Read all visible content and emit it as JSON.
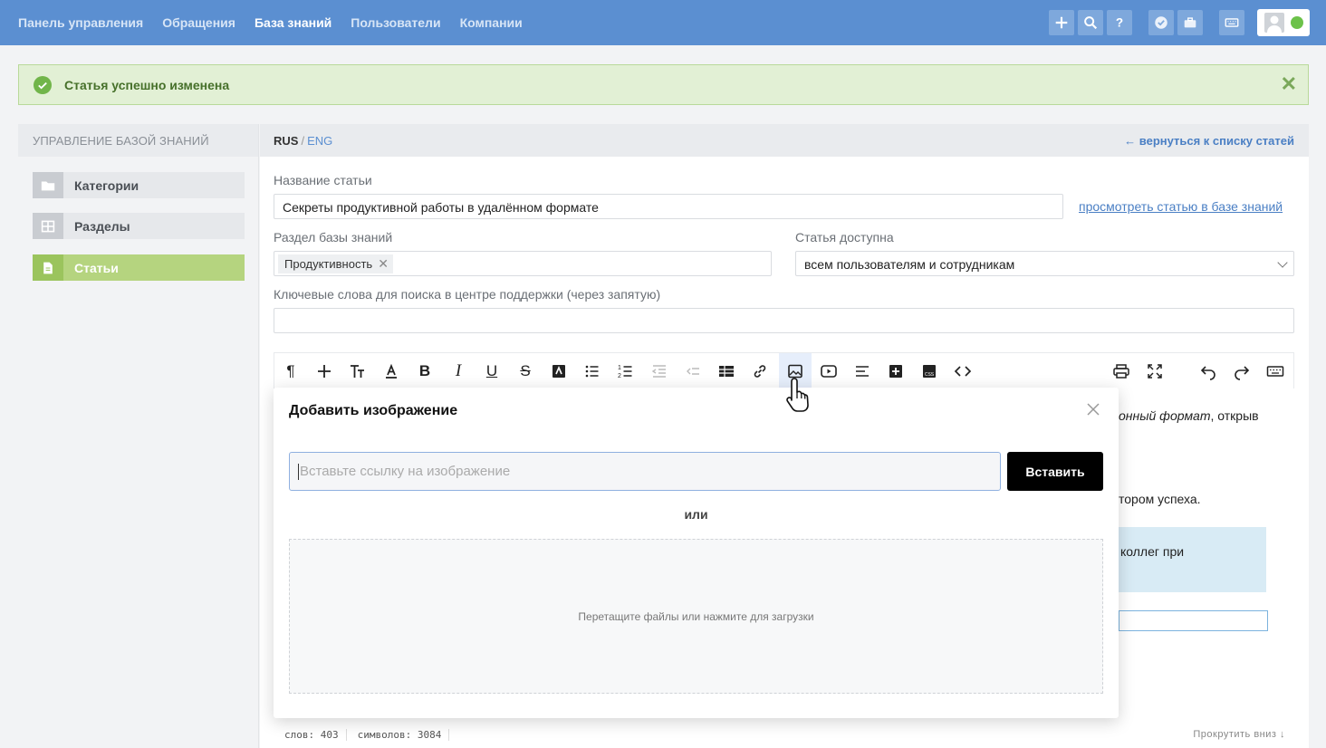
{
  "nav": {
    "items": [
      "Панель управления",
      "Обращения",
      "База знаний",
      "Пользователи",
      "Компании"
    ],
    "active_index": 2
  },
  "top_icons": [
    "plus-icon",
    "search-icon",
    "help-icon",
    "check-circle-icon",
    "briefcase-icon",
    "keyboard-icon",
    "user-avatar-icon",
    "status-online-dot"
  ],
  "alert": {
    "message": "Статья успешно изменена",
    "close": "✕"
  },
  "sidebar": {
    "title": "УПРАВЛЕНИЕ БАЗОЙ ЗНАНИЙ",
    "items": [
      {
        "label": "Категории",
        "icon": "folder-icon"
      },
      {
        "label": "Разделы",
        "icon": "grid-icon"
      },
      {
        "label": "Статьи",
        "icon": "document-icon",
        "active": true
      }
    ]
  },
  "main": {
    "lang_rus": "RUS",
    "lang_sep": "/",
    "lang_eng": "ENG",
    "back_link": "← вернуться к списку статей",
    "title_label": "Название статьи",
    "title_value": "Секреты продуктивной работы в удалённом формате",
    "view_link": "просмотреть статью в базе знаний",
    "section_label": "Раздел базы знаний",
    "section_tag": "Продуктивность",
    "access_label": "Статья доступна",
    "access_value": "всем пользователям и сотрудникам",
    "keywords_label": "Ключевые слова для поиска в центре поддержки (через запятую)",
    "keywords_value": ""
  },
  "editor": {
    "peek_line1_italic": "онный формат",
    "peek_line1_rest": ", открыв",
    "peek_line2": "тором успеха.",
    "peek_quote": "коллег при",
    "status_words": "слов: 403",
    "status_chars": "символов: 3084",
    "scroll_down": "Прокрутить вниз ↓"
  },
  "modal": {
    "title": "Добавить изображение",
    "url_placeholder": "Вставьте ссылку на изображение",
    "insert_button": "Вставить",
    "or_text": "или",
    "dropzone_text": "Перетащите файлы или нажмите для загрузки"
  }
}
